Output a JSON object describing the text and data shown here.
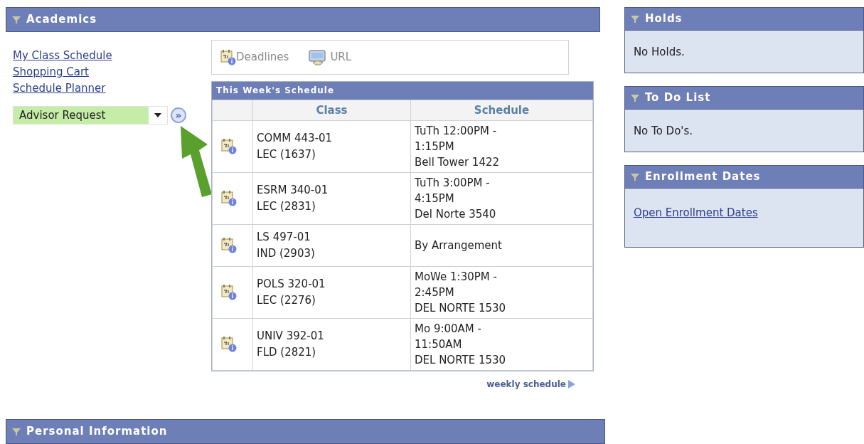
{
  "academics": {
    "title": "Academics",
    "links": [
      "My Class Schedule",
      "Shopping Cart",
      "Schedule Planner"
    ],
    "dropdown": {
      "value": "Advisor Request",
      "go_label": "»"
    },
    "toolbar": [
      "Deadlines",
      "URL"
    ],
    "schedule": {
      "title": "This Week's Schedule",
      "columns": [
        "Class",
        "Schedule"
      ],
      "rows": [
        {
          "class": [
            "COMM 443-01",
            "LEC (1637)"
          ],
          "schedule": [
            "TuTh 12:00PM -",
            "1:15PM",
            "Bell Tower 1422"
          ]
        },
        {
          "class": [
            "ESRM 340-01",
            "LEC (2831)"
          ],
          "schedule": [
            "TuTh 3:00PM -",
            "4:15PM",
            "Del Norte 3540"
          ]
        },
        {
          "class": [
            "LS 497-01",
            "IND (2903)"
          ],
          "schedule": [
            "By Arrangement"
          ]
        },
        {
          "class": [
            "POLS 320-01",
            "LEC (2276)"
          ],
          "schedule": [
            "MoWe 1:30PM -",
            "2:45PM",
            "DEL NORTE 1530"
          ]
        },
        {
          "class": [
            "UNIV 392-01",
            "FLD (2821)"
          ],
          "schedule": [
            "Mo 9:00AM -",
            "11:50AM",
            "DEL NORTE 1530"
          ]
        }
      ],
      "footer_link": "weekly schedule"
    }
  },
  "side_panels": [
    {
      "title": "Holds",
      "kind": "text",
      "body": "No Holds."
    },
    {
      "title": "To Do List",
      "kind": "text",
      "body": "No To Do's."
    },
    {
      "title": "Enrollment Dates",
      "kind": "link",
      "body": "Open Enrollment Dates"
    }
  ],
  "personal": {
    "title": "Personal Information"
  }
}
